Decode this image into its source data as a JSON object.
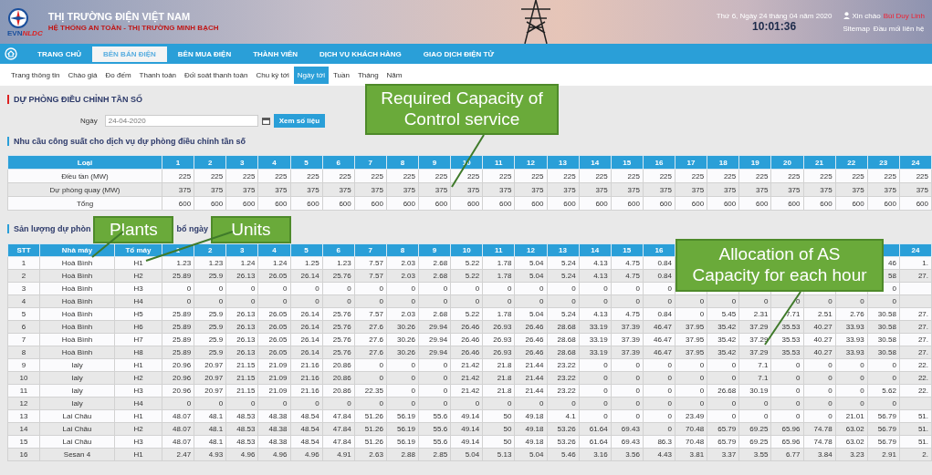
{
  "header": {
    "logo": {
      "prefix": "EVN",
      "suffix": "NLDC"
    },
    "brand_title": "THỊ TRƯỜNG ĐIỆN VIỆT NAM",
    "brand_slogan": "HỆ THỐNG AN TOÀN - THỊ TRƯỜNG MINH BẠCH",
    "date": "Thứ 6, Ngày 24 tháng 04 năm 2020",
    "time": "10:01:36",
    "greeting": "Xin chào",
    "user": "Bùi Duy Linh",
    "links": [
      "Sitemap",
      "Đầu mối liên hệ"
    ]
  },
  "nav": [
    {
      "label": "TRANG CHỦ",
      "selected": false
    },
    {
      "label": "BÊN BÁN ĐIỆN",
      "selected": true
    },
    {
      "label": "BÊN MUA ĐIỆN",
      "selected": false
    },
    {
      "label": "THÀNH VIÊN",
      "selected": false
    },
    {
      "label": "DỊCH VỤ KHÁCH HÀNG",
      "selected": false
    },
    {
      "label": "GIAO DỊCH ĐIỆN TỬ",
      "selected": false
    }
  ],
  "subnav": [
    {
      "label": "Trang thông tin",
      "selected": false
    },
    {
      "label": "Chào giá",
      "selected": false
    },
    {
      "label": "Đo đếm",
      "selected": false
    },
    {
      "label": "Thanh toán",
      "selected": false
    },
    {
      "label": "Đối soát thanh toán",
      "selected": false
    },
    {
      "label": "Chu kỳ tới",
      "selected": false
    },
    {
      "label": "Ngày tới",
      "selected": true
    },
    {
      "label": "Tuần",
      "selected": false
    },
    {
      "label": "Tháng",
      "selected": false
    },
    {
      "label": "Năm",
      "selected": false
    }
  ],
  "section": {
    "title": "DỰ PHÒNG ĐIỀU CHỈNH TẦN SỐ",
    "date_label": "Ngày",
    "date_value": "24-04-2020",
    "view_button": "Xem số liệu"
  },
  "requirement": {
    "title": "Nhu cầu công suất cho dịch vụ dự phòng điều chỉnh tần số",
    "columns": [
      "Loại",
      "1",
      "2",
      "3",
      "4",
      "5",
      "6",
      "7",
      "8",
      "9",
      "10",
      "11",
      "12",
      "13",
      "14",
      "15",
      "16",
      "17",
      "18",
      "19",
      "20",
      "21",
      "22",
      "23",
      "24"
    ],
    "rows": [
      [
        "Điều tần (MW)",
        "225",
        "225",
        "225",
        "225",
        "225",
        "225",
        "225",
        "225",
        "225",
        "225",
        "225",
        "225",
        "225",
        "225",
        "225",
        "225",
        "225",
        "225",
        "225",
        "225",
        "225",
        "225",
        "225",
        "225"
      ],
      [
        "Dự phòng quay (MW)",
        "375",
        "375",
        "375",
        "375",
        "375",
        "375",
        "375",
        "375",
        "375",
        "375",
        "375",
        "375",
        "375",
        "375",
        "375",
        "375",
        "375",
        "375",
        "375",
        "375",
        "375",
        "375",
        "375",
        "375"
      ],
      [
        "Tổng",
        "600",
        "600",
        "600",
        "600",
        "600",
        "600",
        "600",
        "600",
        "600",
        "600",
        "600",
        "600",
        "600",
        "600",
        "600",
        "600",
        "600",
        "600",
        "600",
        "600",
        "600",
        "600",
        "600",
        "600"
      ]
    ]
  },
  "allocation": {
    "title_parts": [
      "Sản lượng dự phòn",
      "bổ ngày"
    ],
    "columns": [
      "STT",
      "Nhà máy",
      "Tổ máy",
      "1",
      "2",
      "3",
      "4",
      "5",
      "6",
      "7",
      "8",
      "9",
      "10",
      "11",
      "12",
      "13",
      "14",
      "15",
      "16",
      null,
      null,
      null,
      null,
      null,
      null,
      null,
      "24"
    ],
    "rows": [
      [
        "1",
        "Hoà Bình",
        "H1",
        "1.23",
        "1.23",
        "1.24",
        "1.24",
        "1.25",
        "1.23",
        "7.57",
        "2.03",
        "2.68",
        "5.22",
        "1.78",
        "5.04",
        "5.24",
        "4.13",
        "4.75",
        "0.84",
        null,
        null,
        null,
        null,
        null,
        null,
        "46",
        "1."
      ],
      [
        "2",
        "Hoà Bình",
        "H2",
        "25.89",
        "25.9",
        "26.13",
        "26.05",
        "26.14",
        "25.76",
        "7.57",
        "2.03",
        "2.68",
        "5.22",
        "1.78",
        "5.04",
        "5.24",
        "4.13",
        "4.75",
        "0.84",
        null,
        null,
        null,
        null,
        null,
        null,
        "58",
        "27."
      ],
      [
        "3",
        "Hoà Bình",
        "H3",
        "0",
        "0",
        "0",
        "0",
        "0",
        "0",
        "0",
        "0",
        "0",
        "0",
        "0",
        "0",
        "0",
        "0",
        "0",
        "0",
        null,
        null,
        null,
        null,
        null,
        null,
        "0",
        null
      ],
      [
        "4",
        "Hoà Bình",
        "H4",
        "0",
        "0",
        "0",
        "0",
        "0",
        "0",
        "0",
        "0",
        "0",
        "0",
        "0",
        "0",
        "0",
        "0",
        "0",
        "0",
        "0",
        "0",
        "0",
        "0",
        "0",
        "0",
        "0",
        null
      ],
      [
        "5",
        "Hoà Bình",
        "H5",
        "25.89",
        "25.9",
        "26.13",
        "26.05",
        "26.14",
        "25.76",
        "7.57",
        "2.03",
        "2.68",
        "5.22",
        "1.78",
        "5.04",
        "5.24",
        "4.13",
        "4.75",
        "0.84",
        "0",
        "5.45",
        "2.31",
        "7.71",
        "2.51",
        "2.76",
        "30.58",
        "27."
      ],
      [
        "6",
        "Hoà Bình",
        "H6",
        "25.89",
        "25.9",
        "26.13",
        "26.05",
        "26.14",
        "25.76",
        "27.6",
        "30.26",
        "29.94",
        "26.46",
        "26.93",
        "26.46",
        "28.68",
        "33.19",
        "37.39",
        "46.47",
        "37.95",
        "35.42",
        "37.29",
        "35.53",
        "40.27",
        "33.93",
        "30.58",
        "27."
      ],
      [
        "7",
        "Hoà Bình",
        "H7",
        "25.89",
        "25.9",
        "26.13",
        "26.05",
        "26.14",
        "25.76",
        "27.6",
        "30.26",
        "29.94",
        "26.46",
        "26.93",
        "26.46",
        "28.68",
        "33.19",
        "37.39",
        "46.47",
        "37.95",
        "35.42",
        "37.29",
        "35.53",
        "40.27",
        "33.93",
        "30.58",
        "27."
      ],
      [
        "8",
        "Hoà Bình",
        "H8",
        "25.89",
        "25.9",
        "26.13",
        "26.05",
        "26.14",
        "25.76",
        "27.6",
        "30.26",
        "29.94",
        "26.46",
        "26.93",
        "26.46",
        "28.68",
        "33.19",
        "37.39",
        "46.47",
        "37.95",
        "35.42",
        "37.29",
        "35.53",
        "40.27",
        "33.93",
        "30.58",
        "27."
      ],
      [
        "9",
        "Ialy",
        "H1",
        "20.96",
        "20.97",
        "21.15",
        "21.09",
        "21.16",
        "20.86",
        "0",
        "0",
        "0",
        "21.42",
        "21.8",
        "21.44",
        "23.22",
        "0",
        "0",
        "0",
        "0",
        "0",
        "7.1",
        "0",
        "0",
        "0",
        "0",
        "22."
      ],
      [
        "10",
        "Ialy",
        "H2",
        "20.96",
        "20.97",
        "21.15",
        "21.09",
        "21.16",
        "20.86",
        "0",
        "0",
        "0",
        "21.42",
        "21.8",
        "21.44",
        "23.22",
        "0",
        "0",
        "0",
        "0",
        "0",
        "7.1",
        "0",
        "0",
        "0",
        "0",
        "22."
      ],
      [
        "11",
        "Ialy",
        "H3",
        "20.96",
        "20.97",
        "21.15",
        "21.09",
        "21.16",
        "20.86",
        "22.35",
        "0",
        "0",
        "21.42",
        "21.8",
        "21.44",
        "23.22",
        "0",
        "0",
        "0",
        "0",
        "26.68",
        "30.19",
        "0",
        "0",
        "0",
        "5.62",
        "22."
      ],
      [
        "12",
        "Ialy",
        "H4",
        "0",
        "0",
        "0",
        "0",
        "0",
        "0",
        "0",
        "0",
        "0",
        "0",
        "0",
        "0",
        "0",
        "0",
        "0",
        "0",
        "0",
        "0",
        "0",
        "0",
        "0",
        "0",
        "0",
        null
      ],
      [
        "13",
        "Lai Châu",
        "H1",
        "48.07",
        "48.1",
        "48.53",
        "48.38",
        "48.54",
        "47.84",
        "51.26",
        "56.19",
        "55.6",
        "49.14",
        "50",
        "49.18",
        "4.1",
        "0",
        "0",
        "0",
        "23.49",
        "0",
        "0",
        "0",
        "0",
        "21.01",
        "56.79",
        "51."
      ],
      [
        "14",
        "Lai Châu",
        "H2",
        "48.07",
        "48.1",
        "48.53",
        "48.38",
        "48.54",
        "47.84",
        "51.26",
        "56.19",
        "55.6",
        "49.14",
        "50",
        "49.18",
        "53.26",
        "61.64",
        "69.43",
        "0",
        "70.48",
        "65.79",
        "69.25",
        "65.96",
        "74.78",
        "63.02",
        "56.79",
        "51."
      ],
      [
        "15",
        "Lai Châu",
        "H3",
        "48.07",
        "48.1",
        "48.53",
        "48.38",
        "48.54",
        "47.84",
        "51.26",
        "56.19",
        "55.6",
        "49.14",
        "50",
        "49.18",
        "53.26",
        "61.64",
        "69.43",
        "86.3",
        "70.48",
        "65.79",
        "69.25",
        "65.96",
        "74.78",
        "63.02",
        "56.79",
        "51."
      ],
      [
        "16",
        "Sesan 4",
        "H1",
        "2.47",
        "4.93",
        "4.96",
        "4.96",
        "4.96",
        "4.91",
        "2.63",
        "2.88",
        "2.85",
        "5.04",
        "5.13",
        "5.04",
        "5.46",
        "3.16",
        "3.56",
        "4.43",
        "3.81",
        "3.37",
        "3.55",
        "6.77",
        "3.84",
        "3.23",
        "2.91",
        "2."
      ]
    ]
  },
  "callouts": [
    {
      "text": "Required Capacity of Control service"
    },
    {
      "text": "Plants"
    },
    {
      "text": "Units"
    },
    {
      "text": "Allocation of AS Capacity for each hour"
    }
  ]
}
